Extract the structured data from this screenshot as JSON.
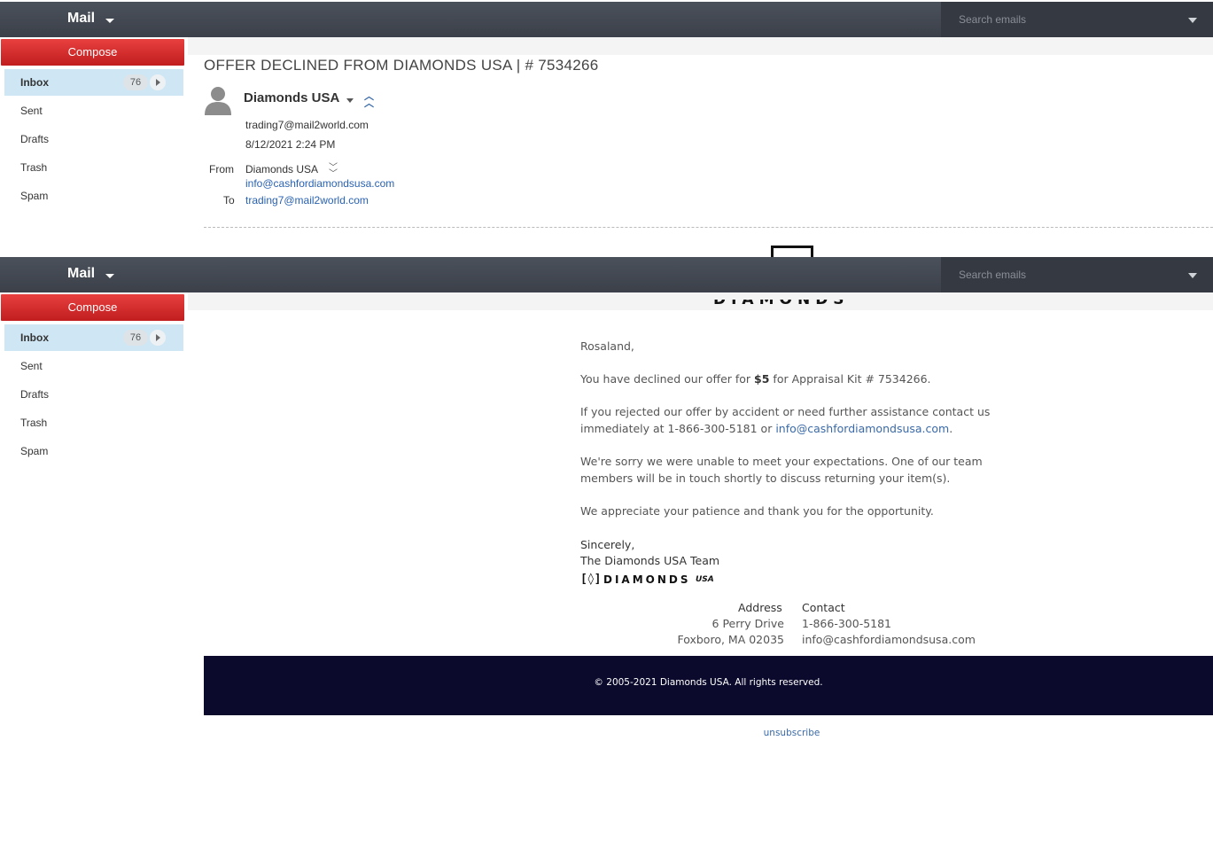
{
  "app": {
    "title": "Mail",
    "search_placeholder": "Search emails",
    "compose_label": "Compose"
  },
  "folders": [
    {
      "label": "Inbox",
      "count": "76",
      "active": true
    },
    {
      "label": "Sent"
    },
    {
      "label": "Drafts"
    },
    {
      "label": "Trash"
    },
    {
      "label": "Spam"
    }
  ],
  "email": {
    "subject": "OFFER DECLINED FROM DIAMONDS USA | # 7534266",
    "sender_name": "Diamonds USA",
    "recipient_address": "trading7@mail2world.com",
    "date": "8/12/2021 2:24 PM",
    "from_label": "From",
    "from_name": "Diamonds USA",
    "from_email": "info@cashfordiamondsusa.com",
    "to_label": "To",
    "to_email": "trading7@mail2world.com"
  },
  "body": {
    "logo_text": "DIAMONDS",
    "logo_suffix": "USA",
    "logo_mark": "[◊]",
    "greeting": "Rosaland,",
    "p1_pre": "You have declined our offer for ",
    "p1_amount": "$5",
    "p1_post": " for Appraisal Kit # 7534266.",
    "p2_pre": "If you rejected our offer by accident or need further assistance contact us immediately at 1-866-300-5181 or ",
    "p2_link": "info@cashfordiamondsusa.com",
    "p2_post": ".",
    "p3": "We're sorry we were unable to meet your expectations. One of our team members will be in touch shortly to discuss returning your item(s).",
    "p4": "We appreciate your patience and thank you for the opportunity.",
    "sign_off": "Sincerely,",
    "team": "The Diamonds USA Team",
    "address_heading": "Address",
    "address_line1": "6 Perry Drive",
    "address_line2": "Foxboro, MA 02035",
    "contact_heading": "Contact",
    "contact_phone": "1-866-300-5181",
    "contact_email": "info@cashfordiamondsusa.com",
    "copyright": "© 2005-2021 Diamonds USA. All rights reserved.",
    "unsubscribe": "unsubscribe"
  },
  "colors": {
    "topbar": "#40454e",
    "compose": "#d32f2f",
    "active_folder": "#cfe7f5",
    "link": "#3a6aa8",
    "footer": "#0b0a2c"
  },
  "icons": {
    "brand_menu": "caret-down-icon",
    "search_menu": "caret-down-icon",
    "avatar": "person-icon",
    "collapse": "double-chevron-up-icon",
    "expand": "double-chevron-down-icon"
  }
}
